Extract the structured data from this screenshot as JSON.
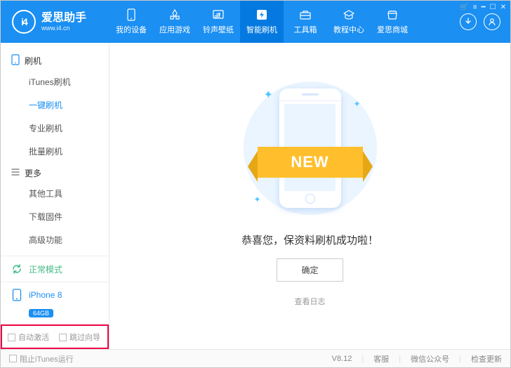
{
  "app": {
    "logo_text": "i4",
    "title": "爱思助手",
    "subtitle": "www.i4.cn"
  },
  "nav": {
    "items": [
      {
        "label": "我的设备",
        "icon": "phone"
      },
      {
        "label": "应用游戏",
        "icon": "apps"
      },
      {
        "label": "铃声壁纸",
        "icon": "music"
      },
      {
        "label": "智能刷机",
        "icon": "flash",
        "active": true
      },
      {
        "label": "工具箱",
        "icon": "toolbox"
      },
      {
        "label": "教程中心",
        "icon": "school"
      },
      {
        "label": "爱思商城",
        "icon": "shop"
      }
    ]
  },
  "sidebar": {
    "groups": [
      {
        "title": "刷机",
        "icon": "device",
        "items": [
          {
            "label": "iTunes刷机",
            "active": false
          },
          {
            "label": "一键刷机",
            "active": true
          },
          {
            "label": "专业刷机",
            "active": false
          },
          {
            "label": "批量刷机",
            "active": false
          }
        ]
      },
      {
        "title": "更多",
        "icon": "list",
        "items": [
          {
            "label": "其他工具",
            "active": false
          },
          {
            "label": "下载固件",
            "active": false
          },
          {
            "label": "高级功能",
            "active": false
          }
        ]
      }
    ],
    "mode": {
      "label": "正常模式"
    },
    "device": {
      "name": "iPhone 8",
      "storage": "64GB"
    },
    "checks": {
      "auto_activate": "自动激活",
      "skip_wizard": "跳过向导"
    }
  },
  "main": {
    "ribbon": "NEW",
    "success_text": "恭喜您，保资料刷机成功啦！",
    "ok_button": "确定",
    "view_log": "查看日志"
  },
  "footer": {
    "block_itunes": "阻止iTunes运行",
    "version": "V8.12",
    "support": "客服",
    "wechat": "微信公众号",
    "update": "检查更新"
  }
}
